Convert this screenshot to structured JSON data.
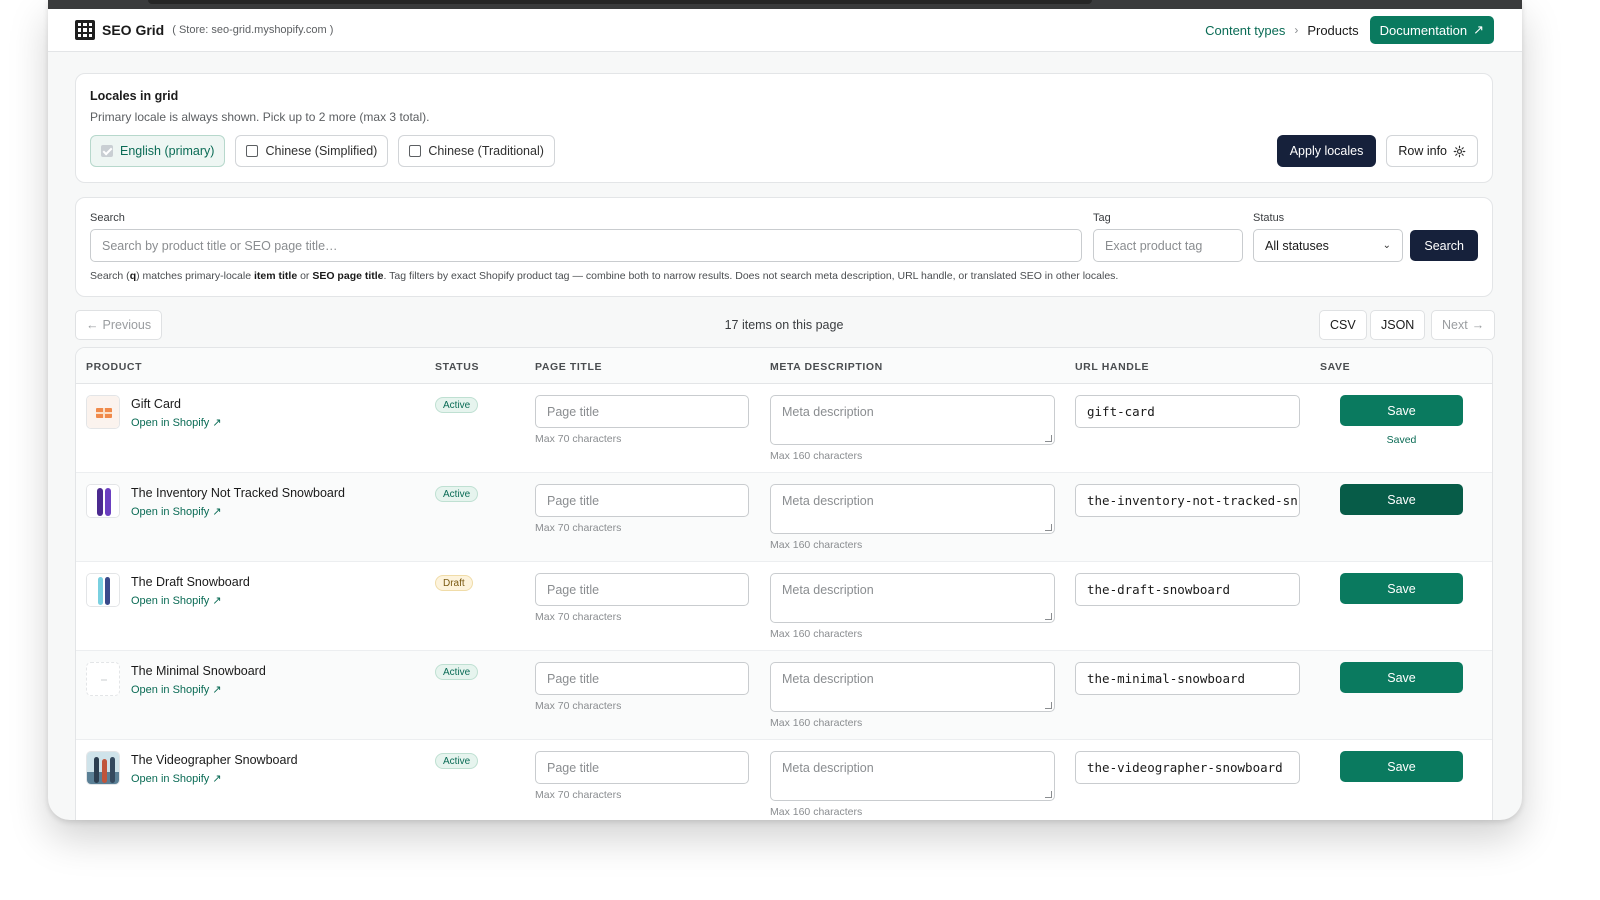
{
  "appbar": {
    "brand": "SEO Grid",
    "store": "( Store: seo-grid.myshopify.com )",
    "crumb_content_types": "Content types",
    "crumb_current": "Products",
    "doc_label": "Documentation"
  },
  "locales": {
    "title": "Locales in grid",
    "subtitle": "Primary locale is always shown. Pick up to 2 more (max 3 total).",
    "options": [
      "English (primary)",
      "Chinese (Simplified)",
      "Chinese (Traditional)"
    ],
    "apply_label": "Apply locales",
    "row_info_label": "Row info"
  },
  "search": {
    "label": "Search",
    "placeholder": "Search by product title or SEO page title…",
    "tag_label": "Tag",
    "tag_placeholder": "Exact product tag",
    "status_label": "Status",
    "status_value": "All statuses",
    "button_label": "Search",
    "help_1": "Search (",
    "help_q": "q",
    "help_2": ") matches primary-locale ",
    "help_item_title": "item title",
    "help_3": " or ",
    "help_seo_title": "SEO page title",
    "help_4": ". Tag filters by exact Shopify product tag — combine both to narrow results. Does not search meta description, URL handle, or translated SEO in other locales."
  },
  "pager": {
    "previous_label": "Previous",
    "count_text": "17 items on this page",
    "csv_label": "CSV",
    "json_label": "JSON",
    "next_label": "Next"
  },
  "table": {
    "headers": {
      "product": "PRODUCT",
      "status": "STATUS",
      "page_title": "PAGE TITLE",
      "meta_description": "META DESCRIPTION",
      "url_handle": "URL HANDLE",
      "save": "SAVE"
    },
    "page_title_placeholder": "Page title",
    "page_title_hint": "Max 70 characters",
    "meta_placeholder": "Meta description",
    "meta_hint": "Max 160 characters",
    "open_link": "Open in Shopify",
    "save_label": "Save",
    "saved_label": "Saved",
    "rows": [
      {
        "name": "Gift Card",
        "status": "Active",
        "handle": "gift-card"
      },
      {
        "name": "The Inventory Not Tracked Snowboard",
        "status": "Active",
        "handle": "the-inventory-not-tracked-sn"
      },
      {
        "name": "The Draft Snowboard",
        "status": "Draft",
        "handle": "the-draft-snowboard"
      },
      {
        "name": "The Minimal Snowboard",
        "status": "Active",
        "handle": "the-minimal-snowboard"
      },
      {
        "name": "The Videographer Snowboard",
        "status": "Active",
        "handle": "the-videographer-snowboard"
      }
    ]
  },
  "colors": {
    "accent": "#0a7a5f",
    "dark_button": "#16213b",
    "link": "#0a6b55"
  },
  "icons": [
    "app-grid-logo",
    "chevron-right-icon",
    "external-link-icon",
    "gear-icon",
    "chevron-down-icon",
    "arrow-left-icon",
    "arrow-right-icon"
  ]
}
